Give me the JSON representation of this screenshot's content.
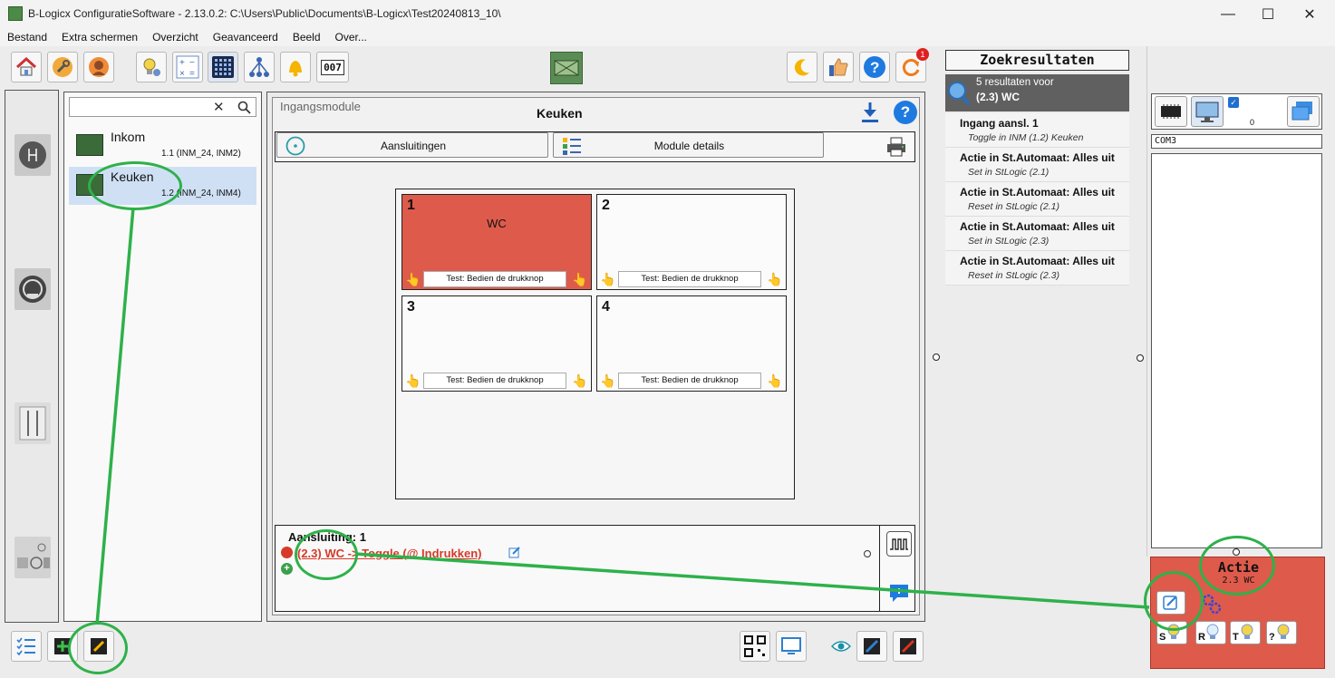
{
  "window": {
    "title": "B-Logicx ConfiguratieSoftware - 2.13.0.2: C:\\Users\\Public\\Documents\\B-Logicx\\Test20240813_10\\",
    "minimize": "—",
    "maximize": "☐",
    "close": "✕"
  },
  "menu": [
    "Bestand",
    "Extra schermen",
    "Overzicht",
    "Geavanceerd",
    "Beeld",
    "Over..."
  ],
  "toolbar": {
    "update_badge": "1",
    "seven_seg": "007"
  },
  "modules": [
    {
      "name": "Inkom",
      "sub": "1.1 (INM_24, INM2)"
    },
    {
      "name": "Keuken",
      "sub": "1.2 (INM_24, INM4)"
    }
  ],
  "main": {
    "module_type": "Ingangsmodule",
    "module_name": "Keuken",
    "tab_connections": "Aansluitingen",
    "tab_details": "Module details",
    "help": "?"
  },
  "cells": [
    {
      "num": "1",
      "label": "WC",
      "test": "Test: Bedien de drukknop",
      "active": true
    },
    {
      "num": "2",
      "label": "",
      "test": "Test: Bedien de drukknop",
      "active": false
    },
    {
      "num": "3",
      "label": "",
      "test": "Test: Bedien de drukknop",
      "active": false
    },
    {
      "num": "4",
      "label": "",
      "test": "Test: Bedien de drukknop",
      "active": false
    }
  ],
  "connection": {
    "title": "Aansluiting: 1",
    "action": "(2.3) WC -> Toggle  (@ Indrukken)"
  },
  "search": {
    "header": "Zoekresultaten",
    "count": "5 resultaten voor",
    "query": "(2.3) WC",
    "results": [
      {
        "title": "Ingang aansl. 1",
        "sub": "Toggle in INM (1.2) Keuken"
      },
      {
        "title": "Actie in St.Automaat:  Alles uit",
        "sub": "Set in StLogic (2.1)"
      },
      {
        "title": "Actie in St.Automaat:  Alles uit",
        "sub": "Reset in StLogic (2.1)"
      },
      {
        "title": "Actie in St.Automaat:  Alles uit",
        "sub": "Set in StLogic (2.3)"
      },
      {
        "title": "Actie in St.Automaat:  Alles uit",
        "sub": "Reset in StLogic (2.3)"
      }
    ]
  },
  "right": {
    "count": "0",
    "port": "COM3",
    "actie_title": "Actie",
    "actie_sub": "2.3 WC",
    "btn_labels": [
      "S",
      "R",
      "T",
      "?"
    ]
  },
  "colors": {
    "accent_red": "#de5b4b",
    "highlight_green": "#2eb14a",
    "selection": "#cfe0f5"
  }
}
